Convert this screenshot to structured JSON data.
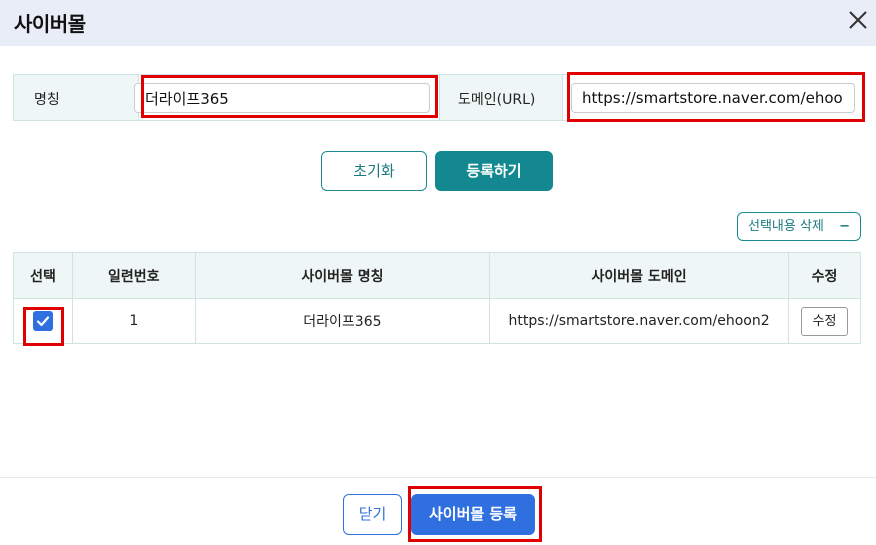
{
  "dialog": {
    "title": "사이버몰"
  },
  "icons": {
    "close": "close-icon",
    "check": "check-icon",
    "minus": "minus-icon"
  },
  "form": {
    "name_label": "명칭",
    "name_value": "더라이프365",
    "domain_label": "도메인(URL)",
    "domain_value": "https://smartstore.naver.com/ehoon"
  },
  "actions": {
    "reset_label": "초기화",
    "register_label": "등록하기",
    "delete_selected_label": "선택내용 삭제",
    "delete_icon": "−"
  },
  "table": {
    "headers": {
      "select": "선택",
      "serial": "일련번호",
      "name": "사이버몰 명칭",
      "domain": "사이버몰 도메인",
      "edit": "수정"
    },
    "rows": [
      {
        "checked": true,
        "serial": "1",
        "name": "더라이프365",
        "domain": "https://smartstore.naver.com/ehoon2",
        "edit_label": "수정"
      }
    ]
  },
  "footer": {
    "close_label": "닫기",
    "save_label": "사이버몰 등록"
  },
  "colors": {
    "teal": "#138890",
    "blue": "#2f6fe0",
    "highlight": "#e00000"
  }
}
